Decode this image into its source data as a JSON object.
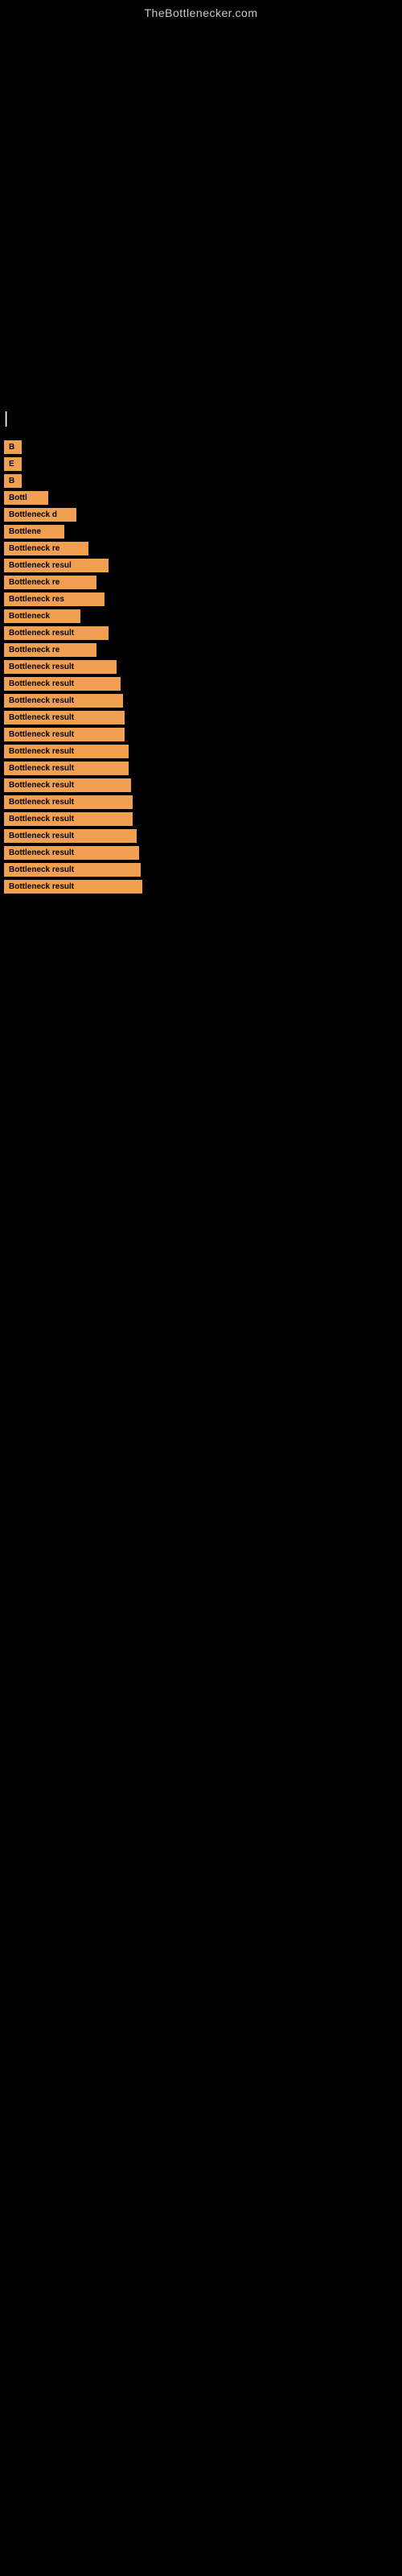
{
  "site": {
    "title": "TheBottlenecker.com"
  },
  "header": {
    "cursor": "|"
  },
  "results": [
    {
      "id": 1,
      "label": "B",
      "rowClass": "row-1"
    },
    {
      "id": 2,
      "label": "E",
      "rowClass": "row-2"
    },
    {
      "id": 3,
      "label": "B",
      "rowClass": "row-3"
    },
    {
      "id": 4,
      "label": "Bottl",
      "rowClass": "row-4"
    },
    {
      "id": 5,
      "label": "Bottleneck d",
      "rowClass": "row-5"
    },
    {
      "id": 6,
      "label": "Bottlene",
      "rowClass": "row-6"
    },
    {
      "id": 7,
      "label": "Bottleneck re",
      "rowClass": "row-7"
    },
    {
      "id": 8,
      "label": "Bottleneck resul",
      "rowClass": "row-8"
    },
    {
      "id": 9,
      "label": "Bottleneck re",
      "rowClass": "row-9"
    },
    {
      "id": 10,
      "label": "Bottleneck res",
      "rowClass": "row-10"
    },
    {
      "id": 11,
      "label": "Bottleneck",
      "rowClass": "row-11"
    },
    {
      "id": 12,
      "label": "Bottleneck result",
      "rowClass": "row-12"
    },
    {
      "id": 13,
      "label": "Bottleneck re",
      "rowClass": "row-13"
    },
    {
      "id": 14,
      "label": "Bottleneck result",
      "rowClass": "row-14"
    },
    {
      "id": 15,
      "label": "Bottleneck result",
      "rowClass": "row-15"
    },
    {
      "id": 16,
      "label": "Bottleneck result",
      "rowClass": "row-16"
    },
    {
      "id": 17,
      "label": "Bottleneck result",
      "rowClass": "row-17"
    },
    {
      "id": 18,
      "label": "Bottleneck result",
      "rowClass": "row-18"
    },
    {
      "id": 19,
      "label": "Bottleneck result",
      "rowClass": "row-19"
    },
    {
      "id": 20,
      "label": "Bottleneck result",
      "rowClass": "row-20"
    },
    {
      "id": 21,
      "label": "Bottleneck result",
      "rowClass": "row-21"
    },
    {
      "id": 22,
      "label": "Bottleneck result",
      "rowClass": "row-22"
    },
    {
      "id": 23,
      "label": "Bottleneck result",
      "rowClass": "row-23"
    },
    {
      "id": 24,
      "label": "Bottleneck result",
      "rowClass": "row-24"
    },
    {
      "id": 25,
      "label": "Bottleneck result",
      "rowClass": "row-25"
    },
    {
      "id": 26,
      "label": "Bottleneck result",
      "rowClass": "row-26"
    },
    {
      "id": 27,
      "label": "Bottleneck result",
      "rowClass": "row-27"
    }
  ]
}
